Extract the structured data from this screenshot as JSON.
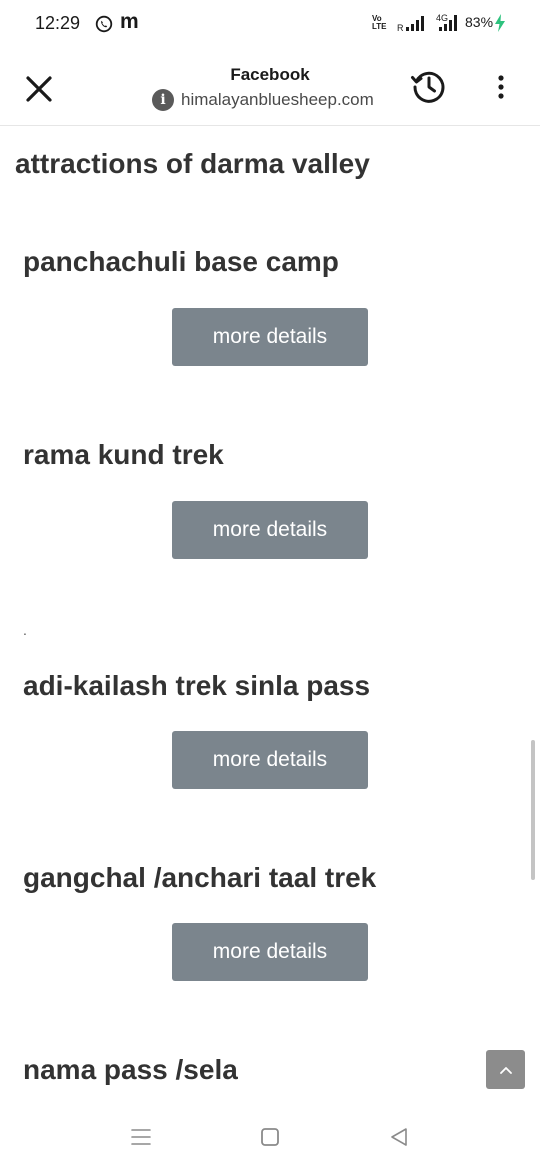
{
  "status_bar": {
    "time": "12:29",
    "app_letter": "m",
    "volte": "Vo\nLTE",
    "battery": "83%",
    "icons": [
      "whatsapp-icon",
      "signal-icon",
      "signal-4g-icon",
      "charging-bolt-icon"
    ]
  },
  "topbar": {
    "title": "Facebook",
    "url": "himalayanbluesheep.com",
    "info_glyph": "i",
    "icons": [
      "close-icon",
      "info-icon",
      "history-icon",
      "more-vert-icon"
    ]
  },
  "content": {
    "heading": "attractions of darma valley",
    "stray_text": ".",
    "treks": [
      {
        "title": "panchachuli base camp",
        "button": "more details"
      },
      {
        "title": "rama kund trek",
        "button": "more details"
      },
      {
        "title": "adi-kailash trek sinla pass",
        "button": "more details"
      },
      {
        "title": "gangchal /anchari taal trek",
        "button": "more details"
      },
      {
        "title": "nama pass /sela"
      }
    ]
  },
  "colors": {
    "button_bg": "#7b858d",
    "heading_text": "#333333",
    "back_to_top_bg": "#8c8c8c",
    "charging_bolt": "#2ec27e"
  },
  "navbar": {
    "icons": [
      "menu-icon",
      "home-icon",
      "back-icon"
    ]
  }
}
